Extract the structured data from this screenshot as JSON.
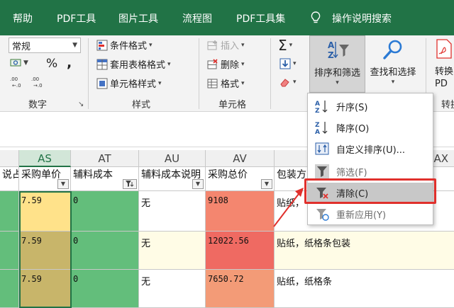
{
  "tabs": [
    "帮助",
    "PDF工具",
    "图片工具",
    "流程图",
    "PDF工具集",
    "操作说明搜索"
  ],
  "ribbon": {
    "number_format": "常规",
    "percent_symbol": "%",
    "comma_symbol": ",",
    "number_group": "数字",
    "conditional_format": "条件格式",
    "table_format": "套用表格格式",
    "cell_style": "单元格样式",
    "style_group": "样式",
    "insert": "插入",
    "delete": "删除",
    "format": "格式",
    "cells_group": "单元格",
    "sort_filter": "排序和筛选",
    "find_select": "查找和选择",
    "convert_partial": "转换",
    "pdf_partial": "PD",
    "convert_group_partial": "转换"
  },
  "columns": [
    "AS",
    "AT",
    "AU",
    "AV",
    "AX"
  ],
  "partial_left_header": "说占",
  "headers": {
    "as": "采购单价",
    "at": "辅料成本",
    "au": "辅料成本说明",
    "av": "采购总价",
    "aw": "包装方"
  },
  "rows": [
    {
      "as": "7.59",
      "at": "0",
      "au": "无",
      "av": "9108",
      "aw": "贴纸，"
    },
    {
      "as": "7.59",
      "at": "0",
      "au": "无",
      "av": "12022.56",
      "aw": "贴纸，纸格条包装"
    },
    {
      "as": "7.59",
      "at": "0",
      "au": "无",
      "av": "7650.72",
      "aw": "贴纸，纸格条"
    }
  ],
  "menu": {
    "ascending": "升序(S)",
    "descending": "降序(O)",
    "custom": "自定义排序(U)...",
    "filter": "筛选(F)",
    "clear": "清除(C)",
    "reapply": "重新应用(Y)"
  },
  "colors": {
    "tab_bar": "#217346",
    "highlight": "#e0302c",
    "av_row1": "#f4866f",
    "av_row2": "#ef6a62",
    "av_row3": "#f39b77"
  }
}
